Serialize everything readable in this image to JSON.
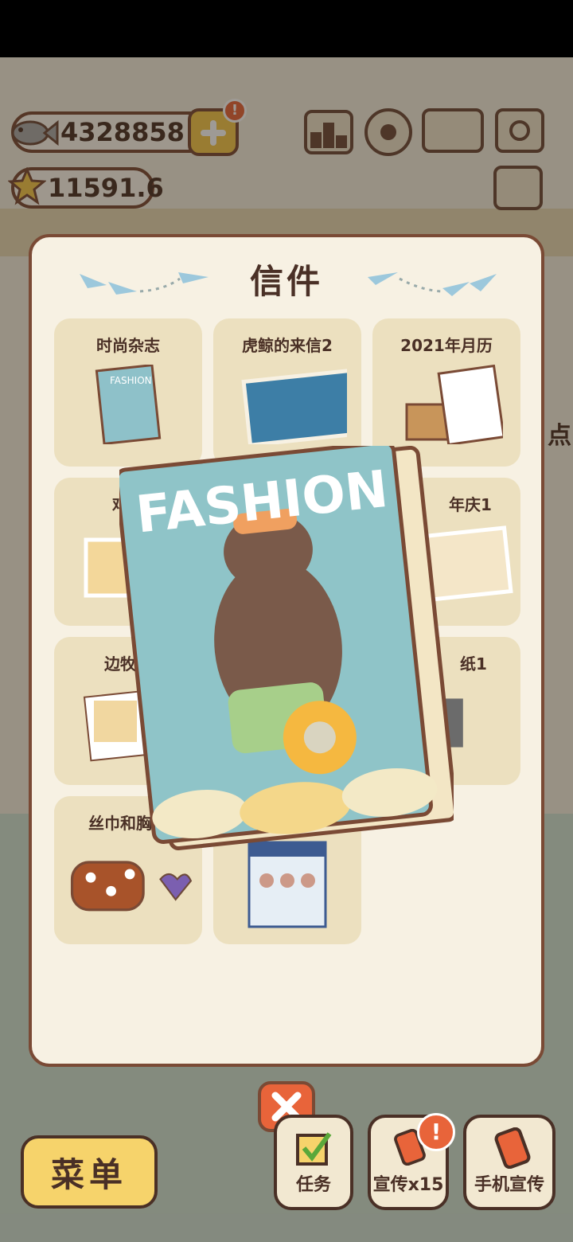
{
  "resources": {
    "fish": "4328858",
    "stars": "11591.6"
  },
  "top_badge": "!",
  "panel": {
    "title": "信件",
    "cards": [
      {
        "label": "时尚杂志"
      },
      {
        "label": "虎鲸的来信2"
      },
      {
        "label": "2021年月历"
      },
      {
        "label": "鸡蛋"
      },
      {
        "label": ""
      },
      {
        "label": "年庆1"
      },
      {
        "label": "边牧的"
      },
      {
        "label": ""
      },
      {
        "label": "纸1"
      },
      {
        "label": "丝巾和胸章"
      },
      {
        "label": ""
      }
    ]
  },
  "magazine": {
    "title": "FASHION"
  },
  "thumb_text": {
    "fashion_small": "FASHION"
  },
  "side_text": "点",
  "bottom": {
    "menu": "菜单",
    "task": "任务",
    "promo": "宣传x15",
    "promo_badge": "!",
    "phone_promo": "手机宣传"
  },
  "colors": {
    "accent": "#e8643a",
    "border": "#7a4a35",
    "gold": "#f6c84b"
  }
}
